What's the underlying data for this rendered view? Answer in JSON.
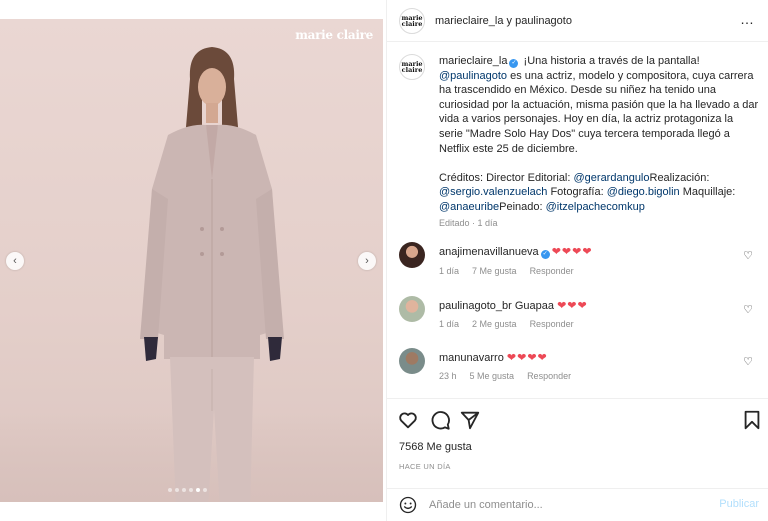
{
  "post": {
    "watermark": "marie claire",
    "carousel": {
      "dot_count": 6,
      "active_dot_index": 4,
      "prev_arrow": "‹",
      "next_arrow": "›"
    }
  },
  "header": {
    "title": "marieclaire_la y paulinagoto",
    "avatar_text": "marie claire",
    "more_icon": "…"
  },
  "caption": {
    "avatar_text": "marie claire",
    "username": "marieclaire_la",
    "text_1": " ¡Una historia a través de la pantalla! ",
    "mention_1": "@paulinagoto",
    "text_2": " es una actriz, modelo y compositora, cuya carrera ha trascendido en México. Desde su niñez ha tenido una curiosidad por la actuación, misma pasión que la ha llevado a dar vida a varios personajes. Hoy en día, la actriz protagoniza la serie \"Madre Solo Hay Dos\" cuya tercera temporada llegó a Netflix este 25 de diciembre.",
    "credits_1": "Créditos: Director Editorial: ",
    "mention_2": "@gerardangulo",
    "credits_2": "Realización: ",
    "mention_3": "@sergio.valenzuelach",
    "credits_3": " Fotografía: ",
    "mention_4": "@diego.bigolin",
    "credits_4": " Maquillaje: ",
    "mention_5": "@anaeuribe",
    "credits_5": "Peinado: ",
    "mention_6": "@itzelpachecomkup",
    "meta": "Editado · 1 día"
  },
  "comments": [
    {
      "user": "anajimenavillanueva",
      "verified": true,
      "text": "",
      "hearts": "❤❤❤❤",
      "time": "1 día",
      "likes": "7 Me gusta",
      "reply": "Responder"
    },
    {
      "user": "paulinagoto_br",
      "verified": false,
      "text": " Guapaa ",
      "hearts": "❤❤❤",
      "time": "1 día",
      "likes": "2 Me gusta",
      "reply": "Responder"
    },
    {
      "user": "manunavarro",
      "verified": false,
      "text": " ",
      "hearts": "❤❤❤❤",
      "time": "23 h",
      "likes": "5 Me gusta",
      "reply": "Responder"
    }
  ],
  "stats": {
    "likes": "7568 Me gusta",
    "time_ago": "HACE UN DÍA"
  },
  "add_comment": {
    "placeholder": "Añade un comentario...",
    "post_label": "Publicar"
  },
  "colors": {
    "link": "#00376b",
    "heart": "#ed4956",
    "verified": "#3897f0",
    "post_disabled": "#b2dffc",
    "photo_bg": "#e7d4d0"
  }
}
